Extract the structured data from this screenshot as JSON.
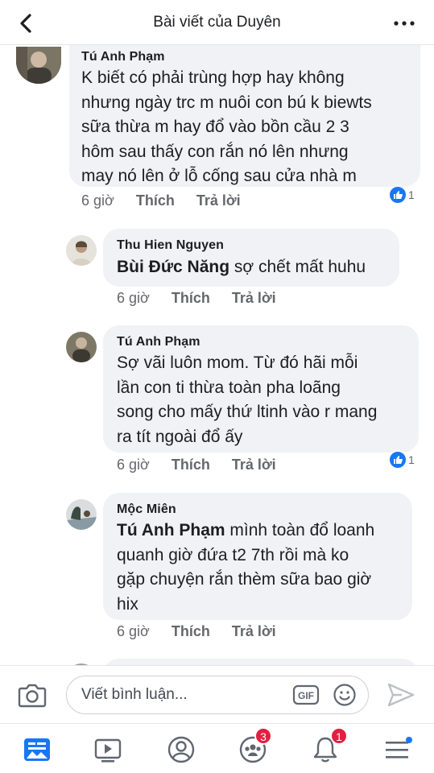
{
  "header": {
    "title": "Bài viết của Duyên",
    "back_icon": "chevron-left-icon",
    "more_icon": "more-dots-icon"
  },
  "comments": [
    {
      "author": "Tú Anh Phạm",
      "mention": "",
      "text": "K biết có phải trùng hợp hay không\nnhưng ngày trc m nuôi con bú k biewts\nsữa thừa m hay đổ vào bồn cầu 2 3\nhôm sau thấy con rắn nó lên nhưng\nmay nó lên ở lỗ cống sau cửa nhà m",
      "time": "6 giờ",
      "like_label": "Thích",
      "reply_label": "Trả lời",
      "reaction_count": "1"
    },
    {
      "author": "Thu Hien Nguyen",
      "mention": "Bùi Đức Năng",
      "text": " sợ chết mất huhu",
      "time": "6 giờ",
      "like_label": "Thích",
      "reply_label": "Trả lời",
      "reaction_count": ""
    },
    {
      "author": "Tú Anh Phạm",
      "mention": "",
      "text": "Sợ vãi luôn mom. Từ đó hãi mỗi\nlần con ti thừa toàn pha loãng\nsong cho mấy thứ ltinh vào r mang\nra tít ngoài đổ ấy",
      "time": "6 giờ",
      "like_label": "Thích",
      "reply_label": "Trả lời",
      "reaction_count": "1"
    },
    {
      "author": "Mộc Miên",
      "mention": "Tú Anh Phạm",
      "text": " mình toàn đổ loanh\nquanh giờ đứa t2 7th rồi mà ko\ngặp chuyện rắn thèm sữa bao giờ\nhix",
      "time": "6 giờ",
      "like_label": "Thích",
      "reply_label": "Trả lời",
      "reaction_count": ""
    }
  ],
  "composer": {
    "placeholder": "Viết bình luận...",
    "gif_label": "GIF",
    "camera_icon": "camera-icon",
    "emoji_icon": "emoji-icon",
    "send_icon": "send-icon"
  },
  "tabbar": {
    "items": [
      "news-feed-icon",
      "watch-icon",
      "profile-icon",
      "groups-icon",
      "notifications-icon",
      "menu-icon"
    ],
    "groups_badge": "3",
    "notifications_badge": "1"
  },
  "colors": {
    "accent": "#1877f2",
    "bubble": "#f0f2f5",
    "meta": "#65676b",
    "badge": "#e41e3f"
  }
}
